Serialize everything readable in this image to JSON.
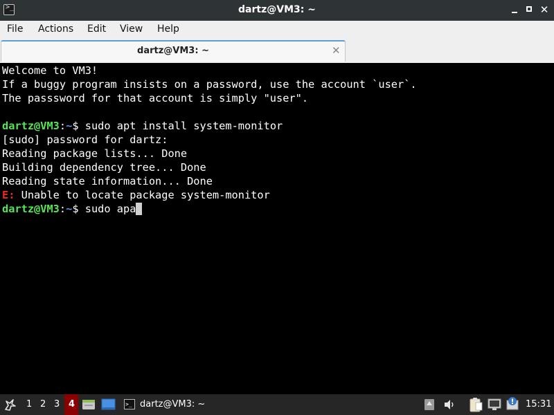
{
  "window": {
    "title": "dartz@VM3: ~",
    "app_icon_glyph": ">_",
    "close_glyph": "✕"
  },
  "menu": {
    "items": [
      "File",
      "Actions",
      "Edit",
      "View",
      "Help"
    ]
  },
  "tab": {
    "label": "dartz@VM3: ~",
    "close_glyph": "✕"
  },
  "terminal": {
    "motd": [
      "Welcome to VM3!",
      "If a buggy program insists on a password, use the account `user`.",
      "The passsword for that account is simply \"user\"."
    ],
    "prompt_user": "dartz@VM3",
    "prompt_sep": ":",
    "prompt_path": "~",
    "prompt_symbol": "$ ",
    "command1": "sudo apt install system-monitor",
    "output": [
      "[sudo] password for dartz:",
      "Reading package lists... Done",
      "Building dependency tree... Done",
      "Reading state information... Done"
    ],
    "error_label": "E:",
    "error_text": " Unable to locate package system-monitor",
    "current_input": "sudo apa"
  },
  "taskbar": {
    "workspaces": [
      "1",
      "2",
      "3",
      "4"
    ],
    "active_workspace": "4",
    "task_label": "dartz@VM3: ~",
    "clock": "15:31",
    "colors": {
      "active_workspace": "#8b0000",
      "background": "#262626"
    }
  }
}
